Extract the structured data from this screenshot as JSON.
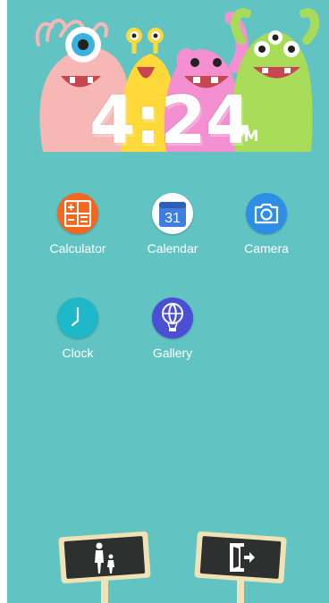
{
  "clock": {
    "time": "4:24",
    "ampm": "PM"
  },
  "apps": [
    {
      "label": "Calculator",
      "icon": "calculator-icon",
      "color": "#f4671f"
    },
    {
      "label": "Calendar",
      "icon": "calendar-icon",
      "color": "#ffffff",
      "day": "31"
    },
    {
      "label": "Camera",
      "icon": "camera-icon",
      "color": "#2d8ee6"
    },
    {
      "label": "Clock",
      "icon": "clock-icon",
      "color": "#1fb8c8"
    },
    {
      "label": "Gallery",
      "icon": "gallery-icon",
      "color": "#4b4fd6"
    }
  ],
  "bottom": {
    "parent_icon": "parent-child-icon",
    "exit_icon": "exit-door-icon"
  },
  "colors": {
    "background": "#62c4c2",
    "sign_board": "#2e302f",
    "sign_frame": "#f1e2b6"
  }
}
